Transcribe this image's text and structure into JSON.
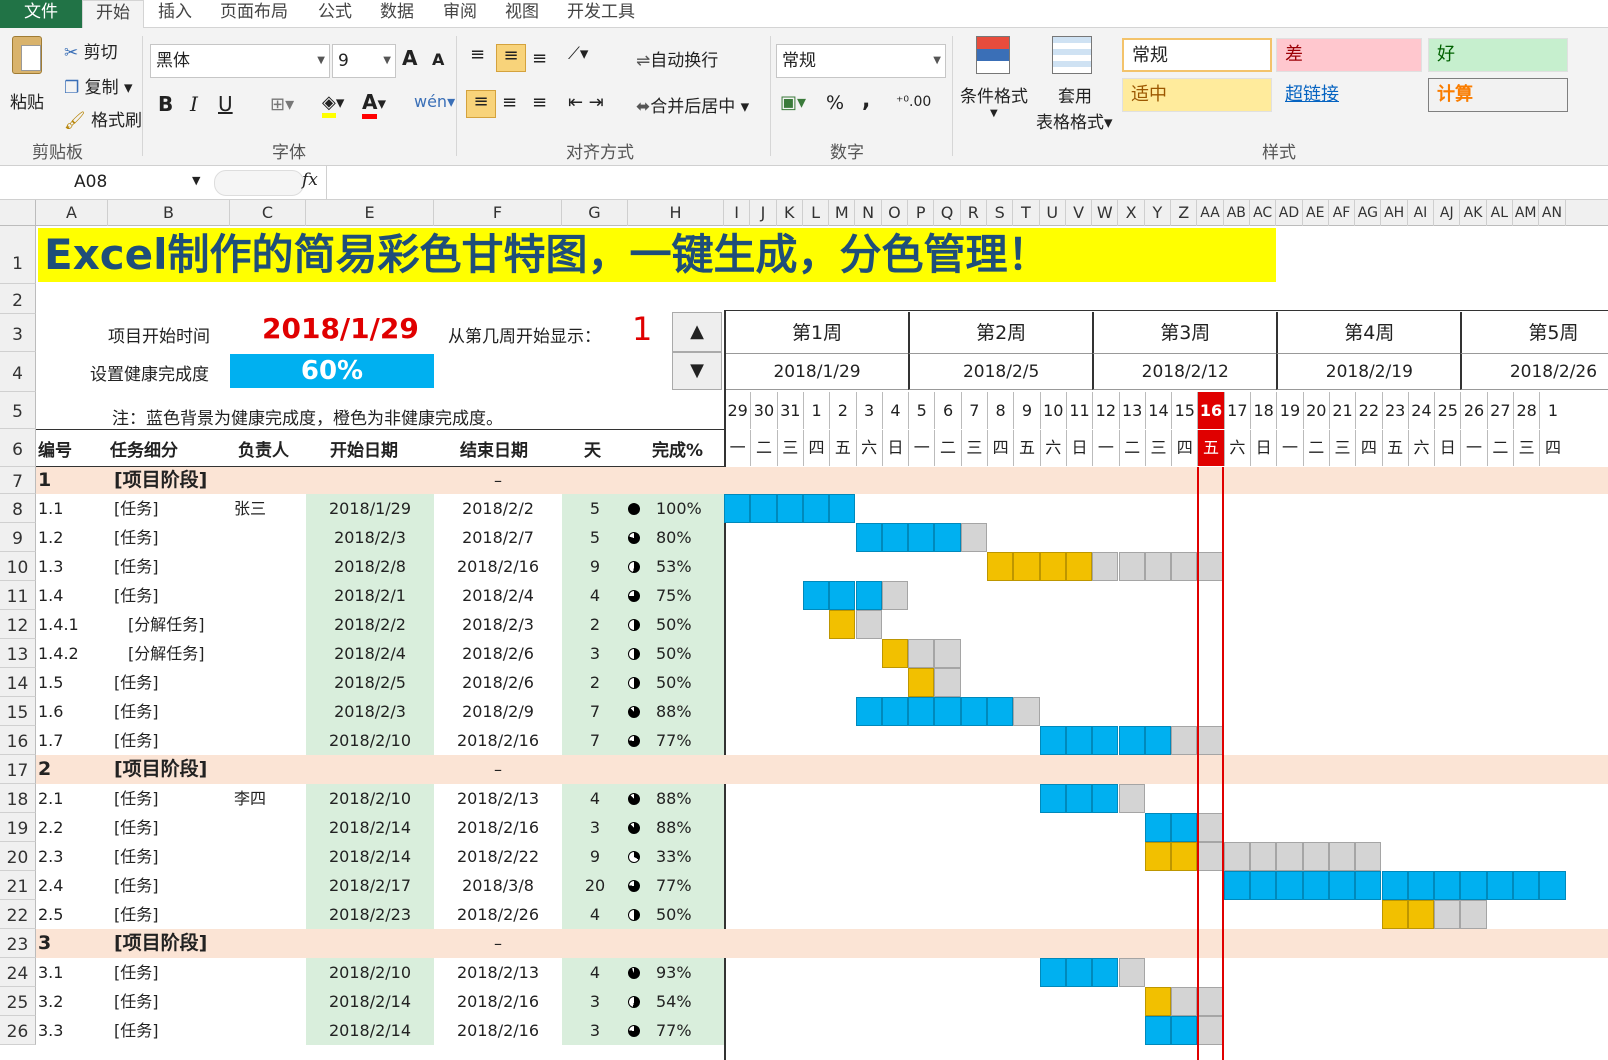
{
  "tabs": [
    "文件",
    "开始",
    "插入",
    "页面布局",
    "公式",
    "数据",
    "审阅",
    "视图",
    "开发工具"
  ],
  "ribbon": {
    "clipboard": {
      "paste": "粘贴",
      "cut": "剪切",
      "copy": "复制",
      "painter": "格式刷",
      "label": "剪贴板"
    },
    "font": {
      "name": "黑体",
      "size": "9",
      "label": "字体",
      "grow": "A",
      "shrink": "A",
      "bold": "B",
      "italic": "I",
      "underline": "U"
    },
    "align": {
      "wrap": "自动换行",
      "merge": "合并后居中",
      "label": "对齐方式"
    },
    "number": {
      "format": "常规",
      "percent": "%",
      "comma": ",",
      "label": "数字"
    },
    "styles": {
      "cond": "条件格式",
      "table": "套用\n表格格式",
      "label": "样式",
      "normal": "常规",
      "bad": "差",
      "good": "好",
      "neutral": "适中",
      "link": "超链接",
      "calc": "计算"
    }
  },
  "formula_bar": {
    "name_box": "A08",
    "fx": "fx",
    "value": ""
  },
  "columns": [
    "A",
    "B",
    "C",
    "E",
    "F",
    "G",
    "H",
    "I",
    "J",
    "K",
    "L",
    "M",
    "N",
    "O",
    "P",
    "Q",
    "R",
    "S",
    "T",
    "U",
    "V",
    "W",
    "X",
    "Y",
    "Z",
    "AA",
    "AB",
    "AC",
    "AD",
    "AE",
    "AF",
    "AG",
    "AH",
    "AI",
    "AJ",
    "AK",
    "AL",
    "AM",
    "AN"
  ],
  "rows": [
    "1",
    "2",
    "3",
    "4",
    "5",
    "6",
    "7",
    "8",
    "9",
    "10",
    "11",
    "12",
    "13",
    "14",
    "15",
    "16",
    "17",
    "18",
    "19",
    "20",
    "21",
    "22",
    "23",
    "24",
    "25",
    "26"
  ],
  "title": "Excel制作的简易彩色甘特图，一键生成，分色管理！",
  "settings": {
    "start_label": "项目开始时间",
    "start_value": "2018/1/29",
    "week_label": "从第几周开始显示：",
    "week_value": "1",
    "health_label": "设置健康完成度",
    "health_value": "60%",
    "note": "注：蓝色背景为健康完成度，橙色为非健康完成度。"
  },
  "headers": [
    "编号",
    "任务细分",
    "负责人",
    "开始日期",
    "结束日期",
    "天",
    "完成%"
  ],
  "weeks": [
    {
      "label": "第1周",
      "date": "2018/1/29"
    },
    {
      "label": "第2周",
      "date": "2018/2/5"
    },
    {
      "label": "第3周",
      "date": "2018/2/12"
    },
    {
      "label": "第4周",
      "date": "2018/2/19"
    },
    {
      "label": "第5周",
      "date": "2018/2/26"
    }
  ],
  "days": [
    "29",
    "30",
    "31",
    "1",
    "2",
    "3",
    "4",
    "5",
    "6",
    "7",
    "8",
    "9",
    "10",
    "11",
    "12",
    "13",
    "14",
    "15",
    "16",
    "17",
    "18",
    "19",
    "20",
    "21",
    "22",
    "23",
    "24",
    "25",
    "26",
    "27",
    "28",
    "1"
  ],
  "weekdays": [
    "一",
    "二",
    "三",
    "四",
    "五",
    "六",
    "日",
    "一",
    "二",
    "三",
    "四",
    "五",
    "六",
    "日",
    "一",
    "二",
    "三",
    "四",
    "五",
    "六",
    "日",
    "一",
    "二",
    "三",
    "四",
    "五",
    "六",
    "日",
    "一",
    "二",
    "三",
    "四"
  ],
  "today_index": 18,
  "colors": {
    "blue": "#00b0f0",
    "orange": "#f2c000",
    "gray": "#d4d4d4",
    "phase": "#fbe4d5",
    "green": "#d9eedc",
    "today": "#e00000",
    "yellow": "#ffff00",
    "title": "#1f4e79"
  },
  "tasks": [
    {
      "id": "1",
      "name": "[项目阶段]",
      "owner": "",
      "start": "",
      "end": "–",
      "days": "",
      "pct": "",
      "phase": true
    },
    {
      "id": "1.1",
      "name": "[任务]",
      "owner": "张三",
      "start": "2018/1/29",
      "end": "2018/2/2",
      "days": "5",
      "pct": "100%",
      "s": 0,
      "d": 5,
      "done": 5,
      "color": "blue"
    },
    {
      "id": "1.2",
      "name": "[任务]",
      "owner": "",
      "start": "2018/2/3",
      "end": "2018/2/7",
      "days": "5",
      "pct": "80%",
      "s": 5,
      "d": 5,
      "done": 4,
      "color": "blue"
    },
    {
      "id": "1.3",
      "name": "[任务]",
      "owner": "",
      "start": "2018/2/8",
      "end": "2018/2/16",
      "days": "9",
      "pct": "53%",
      "s": 10,
      "d": 9,
      "done": 4,
      "color": "orange"
    },
    {
      "id": "1.4",
      "name": "[任务]",
      "owner": "",
      "start": "2018/2/1",
      "end": "2018/2/4",
      "days": "4",
      "pct": "75%",
      "s": 3,
      "d": 4,
      "done": 3,
      "color": "blue"
    },
    {
      "id": "1.4.1",
      "name": "[分解任务]",
      "owner": "",
      "start": "2018/2/2",
      "end": "2018/2/3",
      "days": "2",
      "pct": "50%",
      "s": 4,
      "d": 2,
      "done": 1,
      "color": "orange",
      "indent": true
    },
    {
      "id": "1.4.2",
      "name": "[分解任务]",
      "owner": "",
      "start": "2018/2/4",
      "end": "2018/2/6",
      "days": "3",
      "pct": "50%",
      "s": 6,
      "d": 3,
      "done": 1,
      "color": "orange",
      "indent": true
    },
    {
      "id": "1.5",
      "name": "[任务]",
      "owner": "",
      "start": "2018/2/5",
      "end": "2018/2/6",
      "days": "2",
      "pct": "50%",
      "s": 7,
      "d": 2,
      "done": 1,
      "color": "orange"
    },
    {
      "id": "1.6",
      "name": "[任务]",
      "owner": "",
      "start": "2018/2/3",
      "end": "2018/2/9",
      "days": "7",
      "pct": "88%",
      "s": 5,
      "d": 7,
      "done": 6,
      "color": "blue"
    },
    {
      "id": "1.7",
      "name": "[任务]",
      "owner": "",
      "start": "2018/2/10",
      "end": "2018/2/16",
      "days": "7",
      "pct": "77%",
      "s": 12,
      "d": 7,
      "done": 5,
      "color": "blue"
    },
    {
      "id": "2",
      "name": "[项目阶段]",
      "owner": "",
      "start": "",
      "end": "–",
      "days": "",
      "pct": "",
      "phase": true
    },
    {
      "id": "2.1",
      "name": "[任务]",
      "owner": "李四",
      "start": "2018/2/10",
      "end": "2018/2/13",
      "days": "4",
      "pct": "88%",
      "s": 12,
      "d": 4,
      "done": 3,
      "color": "blue"
    },
    {
      "id": "2.2",
      "name": "[任务]",
      "owner": "",
      "start": "2018/2/14",
      "end": "2018/2/16",
      "days": "3",
      "pct": "88%",
      "s": 16,
      "d": 3,
      "done": 2,
      "color": "blue"
    },
    {
      "id": "2.3",
      "name": "[任务]",
      "owner": "",
      "start": "2018/2/14",
      "end": "2018/2/22",
      "days": "9",
      "pct": "33%",
      "s": 16,
      "d": 9,
      "done": 2,
      "color": "orange"
    },
    {
      "id": "2.4",
      "name": "[任务]",
      "owner": "",
      "start": "2018/2/17",
      "end": "2018/3/8",
      "days": "20",
      "pct": "77%",
      "s": 19,
      "d": 13,
      "done": 13,
      "color": "blue"
    },
    {
      "id": "2.5",
      "name": "[任务]",
      "owner": "",
      "start": "2018/2/23",
      "end": "2018/2/26",
      "days": "4",
      "pct": "50%",
      "s": 25,
      "d": 4,
      "done": 2,
      "color": "orange"
    },
    {
      "id": "3",
      "name": "[项目阶段]",
      "owner": "",
      "start": "",
      "end": "–",
      "days": "",
      "pct": "",
      "phase": true
    },
    {
      "id": "3.1",
      "name": "[任务]",
      "owner": "",
      "start": "2018/2/10",
      "end": "2018/2/13",
      "days": "4",
      "pct": "93%",
      "s": 12,
      "d": 4,
      "done": 3,
      "color": "blue"
    },
    {
      "id": "3.2",
      "name": "[任务]",
      "owner": "",
      "start": "2018/2/14",
      "end": "2018/2/16",
      "days": "3",
      "pct": "54%",
      "s": 16,
      "d": 3,
      "done": 1,
      "color": "orange"
    },
    {
      "id": "3.3",
      "name": "[任务]",
      "owner": "",
      "start": "2018/2/14",
      "end": "2018/2/16",
      "days": "3",
      "pct": "77%",
      "s": 16,
      "d": 3,
      "done": 2,
      "color": "blue"
    }
  ]
}
